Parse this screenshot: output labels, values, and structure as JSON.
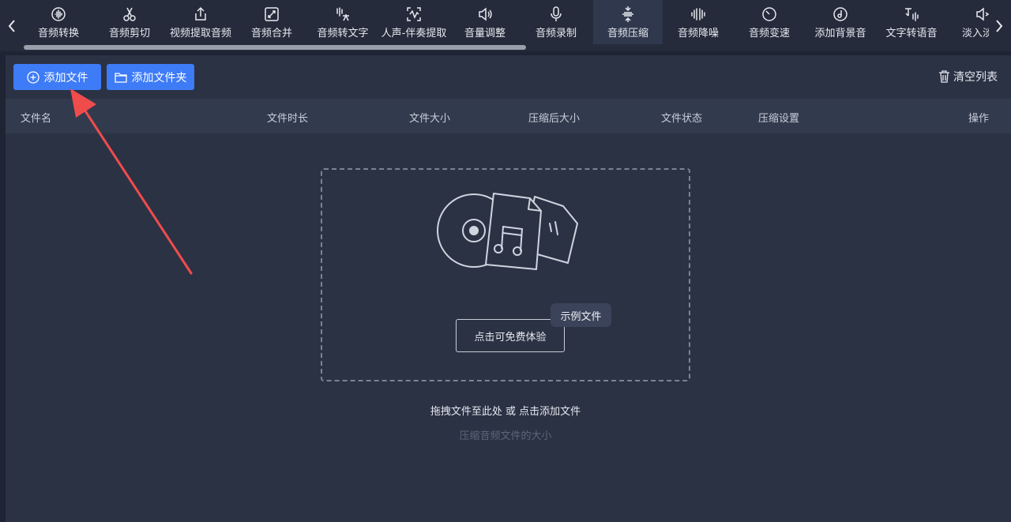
{
  "toolbar": {
    "prev_icon": "chevron-left-icon",
    "next_icon": "chevron-right-icon",
    "active_color": "#2f384d",
    "items": [
      {
        "label": "音频转换",
        "icon": "audio-wave-circle-icon"
      },
      {
        "label": "音频剪切",
        "icon": "scissors-icon"
      },
      {
        "label": "视频提取音频",
        "icon": "upload-icon"
      },
      {
        "label": "音频合并",
        "icon": "merge-arrows-icon"
      },
      {
        "label": "音频转文字",
        "icon": "speech-to-text-icon"
      },
      {
        "label": "人声-伴奏提取",
        "icon": "voice-extract-icon"
      },
      {
        "label": "音量调整",
        "icon": "speaker-icon"
      },
      {
        "label": "音频录制",
        "icon": "microphone-icon"
      },
      {
        "label": "音频压缩",
        "icon": "compress-icon"
      },
      {
        "label": "音频降噪",
        "icon": "noise-bars-icon"
      },
      {
        "label": "音频变速",
        "icon": "speedometer-icon"
      },
      {
        "label": "添加背景音",
        "icon": "music-disc-icon"
      },
      {
        "label": "文字转语音",
        "icon": "text-to-speech-icon"
      },
      {
        "label": "淡入淡出",
        "icon": "fade-icon"
      }
    ],
    "active_index": 8
  },
  "actions": {
    "add_file": "添加文件",
    "add_folder": "添加文件夹",
    "clear_list": "清空列表",
    "accent_color": "#3d7bf7"
  },
  "table": {
    "columns": [
      "文件名",
      "文件时长",
      "文件大小",
      "压缩后大小",
      "文件状态",
      "压缩设置",
      "操作"
    ]
  },
  "empty_state": {
    "illustration": "disc-and-music-files-icon",
    "trial_button": "点击可免费体验",
    "sample_badge": "示例文件",
    "hint_main": "拖拽文件至此处 或 点击添加文件",
    "hint_sub": "压缩音频文件的大小"
  },
  "annotation": {
    "arrow_color": "#f04c4c"
  }
}
